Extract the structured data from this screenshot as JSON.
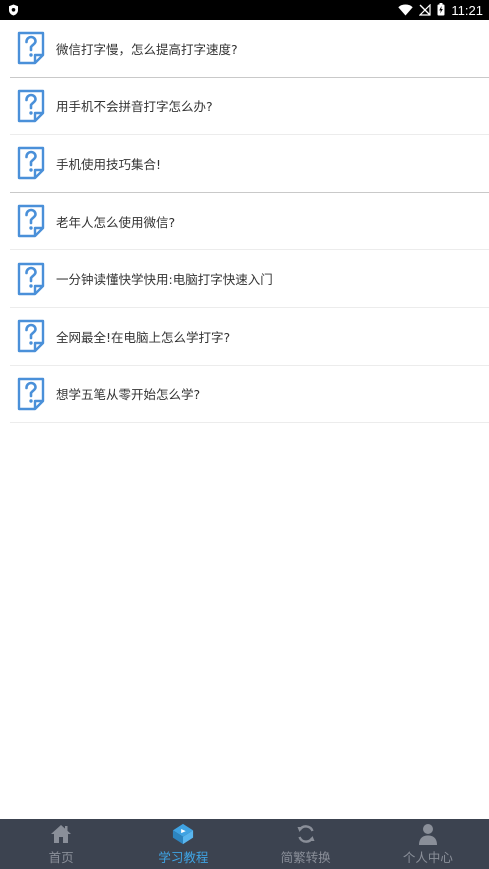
{
  "status_bar": {
    "time": "11:21"
  },
  "colors": {
    "icon_blue": "#4a90d9",
    "nav_background": "#3c4350",
    "nav_active": "#3fa3e3",
    "nav_inactive": "#8a8f99"
  },
  "list": {
    "items": [
      {
        "label": "微信打字慢，怎么提高打字速度?",
        "icon": "question-doc-icon"
      },
      {
        "label": "用手机不会拼音打字怎么办?",
        "icon": "question-doc-icon"
      },
      {
        "label": "手机使用技巧集合!",
        "icon": "question-doc-icon"
      },
      {
        "label": "老年人怎么使用微信?",
        "icon": "question-doc-icon"
      },
      {
        "label": "一分钟读懂快学快用:电脑打字快速入门",
        "icon": "question-doc-icon"
      },
      {
        "label": "全网最全!在电脑上怎么学打字?",
        "icon": "question-doc-icon"
      },
      {
        "label": "想学五笔从零开始怎么学?",
        "icon": "question-doc-icon"
      }
    ]
  },
  "bottom_nav": {
    "items": [
      {
        "label": "首页",
        "icon": "home-icon",
        "active": false
      },
      {
        "label": "学习教程",
        "icon": "tutorial-icon",
        "active": true
      },
      {
        "label": "简繁转换",
        "icon": "convert-icon",
        "active": false
      },
      {
        "label": "个人中心",
        "icon": "user-icon",
        "active": false
      }
    ]
  }
}
